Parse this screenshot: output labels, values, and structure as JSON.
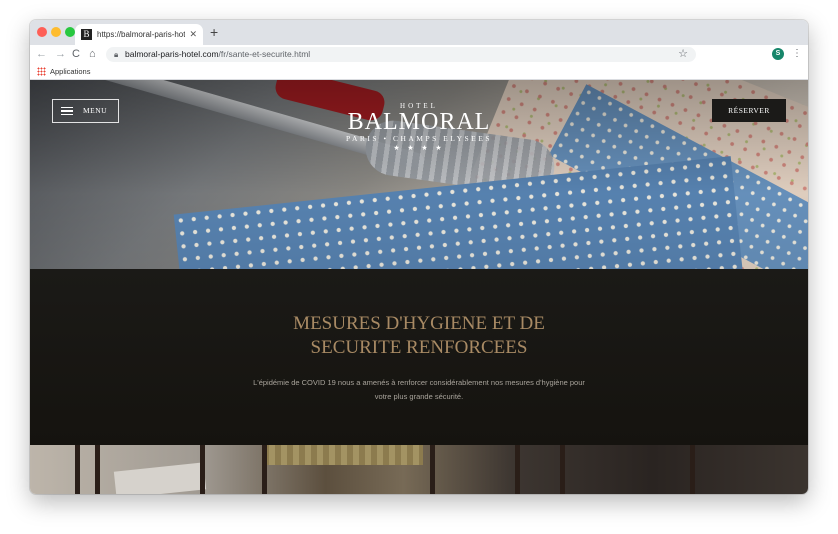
{
  "browser": {
    "tab": {
      "favicon_letter": "B",
      "title": "https://balmoral-paris-hotel.co",
      "close_icon": "close-icon"
    },
    "new_tab_label": "+",
    "toolbar": {
      "back_icon": "←",
      "forward_icon": "→",
      "reload_icon": "C",
      "home_icon": "⌂",
      "url_host": "balmoral-paris-hotel.com",
      "url_path": "/fr/sante-et-securite.html",
      "star_icon": "☆",
      "profile_initial": "S",
      "menu_icon": "⋮"
    },
    "bookmarks": {
      "apps_label": "Applications"
    }
  },
  "site": {
    "menu_label": "MENU",
    "reserve_label": "RÉSERVER",
    "logo": {
      "hotel": "HOTEL",
      "name": "BALMORAL",
      "subtitle": "PARIS • CHAMPS ELYSEES",
      "stars": "★ ★ ★ ★"
    },
    "heading_line1": "MESURES D'HYGIENE ET DE",
    "heading_line2": "SECURITE RENFORCEES",
    "intro_line1": "L'épidémie de COVID 19 nous a amenés à renforcer considérablement nos mesures d'hygiène pour",
    "intro_line2": "votre plus grande sécurité."
  },
  "colors": {
    "heading": "#a88a64",
    "band": "#1b1a17",
    "reserve_button": "#1b1a18",
    "profile": "#16866a"
  }
}
